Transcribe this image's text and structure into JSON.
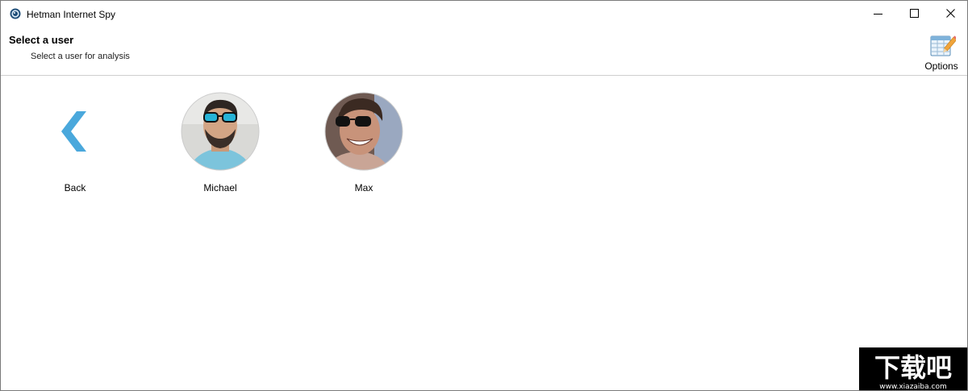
{
  "window": {
    "title": "Hetman Internet Spy",
    "controls": [
      "minimize-icon",
      "maximize-icon",
      "close-icon"
    ]
  },
  "header": {
    "title": "Select a user",
    "subtitle": "Select a user for analysis",
    "options_label": "Options"
  },
  "users": [
    {
      "label": "Back",
      "icon": "back-chevron-icon"
    },
    {
      "label": "Michael",
      "icon": "user-avatar"
    },
    {
      "label": "Max",
      "icon": "user-avatar"
    }
  ],
  "colors": {
    "accent": "#4aa8dc",
    "separator": "#cfcfcf"
  },
  "watermark": {
    "text": "下载吧",
    "url_text": "www.xiazaiba.com"
  }
}
